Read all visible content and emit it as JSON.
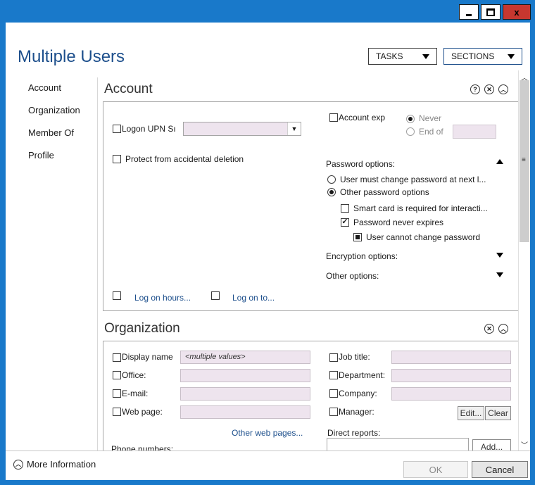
{
  "window": {
    "minimize_label": "▁",
    "maximize_label": "▢",
    "close_label": "x"
  },
  "header": {
    "title": "Multiple Users",
    "tasks_label": "TASKS",
    "sections_label": "SECTIONS"
  },
  "nav": {
    "items": [
      {
        "label": "Account"
      },
      {
        "label": "Organization"
      },
      {
        "label": "Member Of"
      },
      {
        "label": "Profile"
      }
    ]
  },
  "account": {
    "title": "Account",
    "logon_upn_label": "Logon UPN Sı",
    "protect_label": "Protect from accidental deletion",
    "account_exp_label": "Account exp",
    "never_label": "Never",
    "end_of_label": "End of",
    "password_options_label": "Password options:",
    "must_change_label": "User must change password at next l...",
    "other_password_label": "Other password options",
    "smart_card_label": "Smart card is required for interacti...",
    "never_expires_label": "Password never expires",
    "cannot_change_label": "User cannot change password",
    "encryption_label": "Encryption options:",
    "other_options_label": "Other options:",
    "logon_hours_label": "Log on hours...",
    "logon_to_label": "Log on to..."
  },
  "organization": {
    "title": "Organization",
    "display_name_label": "Display name",
    "display_name_value": "<multiple values>",
    "office_label": "Office:",
    "email_label": "E-mail:",
    "web_page_label": "Web page:",
    "other_web_pages_label": "Other web pages...",
    "phone_numbers_label": "Phone numbers:",
    "job_title_label": "Job title:",
    "department_label": "Department:",
    "company_label": "Company:",
    "manager_label": "Manager:",
    "edit_label": "Edit...",
    "clear_label": "Clear",
    "direct_reports_label": "Direct reports:",
    "add_label": "Add..."
  },
  "footer": {
    "more_info_label": "More Information",
    "ok_label": "OK",
    "cancel_label": "Cancel"
  },
  "colors": {
    "titlebar": "#1979ca",
    "close": "#c7372f",
    "title_text": "#1d4f8c",
    "field_bg": "#eee4ee"
  }
}
